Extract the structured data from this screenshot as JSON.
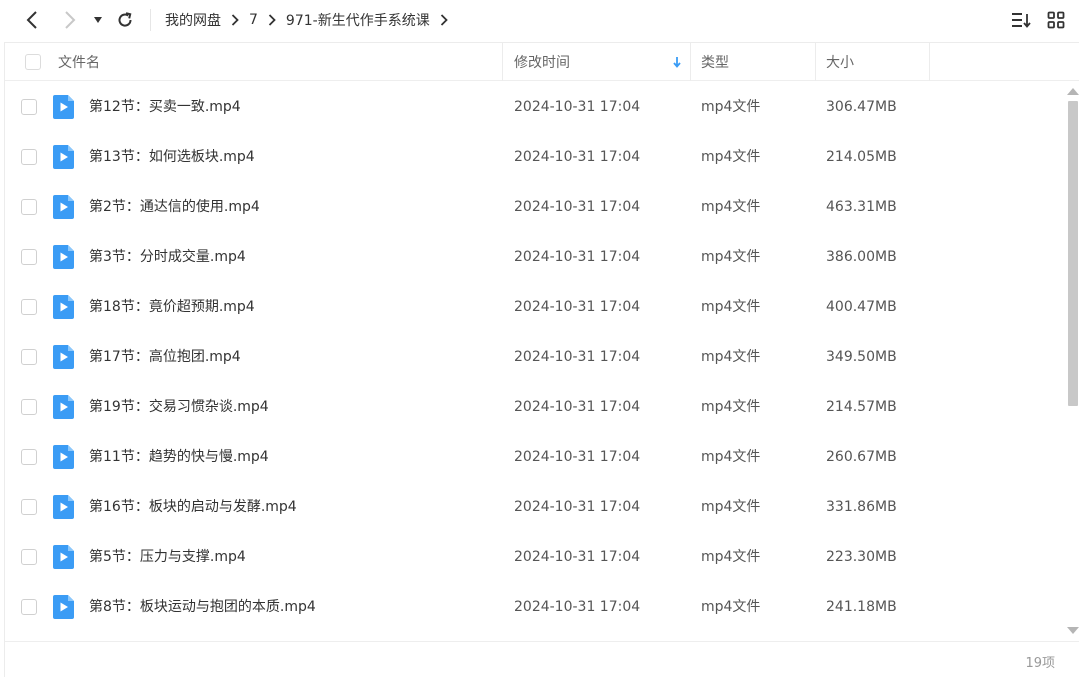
{
  "toolbar": {
    "back_icon": "chevron-left-icon",
    "forward_icon": "chevron-right-icon",
    "dropdown_icon": "caret-down-icon",
    "refresh_icon": "refresh-icon",
    "sort_icon": "sort-list-icon",
    "view_icon": "grid-view-icon"
  },
  "breadcrumb": {
    "items": [
      "我的网盘",
      "7",
      "971-新生代作手系统课"
    ]
  },
  "table": {
    "headers": {
      "name": "文件名",
      "modified": "修改时间",
      "type": "类型",
      "size": "大小"
    },
    "sort_indicator": "arrow-down-icon",
    "accent": "#3b9cf5",
    "rows": [
      {
        "name": "第12节：买卖一致.mp4",
        "modified": "2024-10-31 17:04",
        "type": "mp4文件",
        "size": "306.47MB"
      },
      {
        "name": "第13节：如何选板块.mp4",
        "modified": "2024-10-31 17:04",
        "type": "mp4文件",
        "size": "214.05MB"
      },
      {
        "name": "第2节：通达信的使用.mp4",
        "modified": "2024-10-31 17:04",
        "type": "mp4文件",
        "size": "463.31MB"
      },
      {
        "name": "第3节：分时成交量.mp4",
        "modified": "2024-10-31 17:04",
        "type": "mp4文件",
        "size": "386.00MB"
      },
      {
        "name": "第18节：竟价超预期.mp4",
        "modified": "2024-10-31 17:04",
        "type": "mp4文件",
        "size": "400.47MB"
      },
      {
        "name": "第17节：高位抱团.mp4",
        "modified": "2024-10-31 17:04",
        "type": "mp4文件",
        "size": "349.50MB"
      },
      {
        "name": "第19节：交易习惯杂谈.mp4",
        "modified": "2024-10-31 17:04",
        "type": "mp4文件",
        "size": "214.57MB"
      },
      {
        "name": "第11节：趋势的快与慢.mp4",
        "modified": "2024-10-31 17:04",
        "type": "mp4文件",
        "size": "260.67MB"
      },
      {
        "name": "第16节：板块的启动与发酵.mp4",
        "modified": "2024-10-31 17:04",
        "type": "mp4文件",
        "size": "331.86MB"
      },
      {
        "name": "第5节：压力与支撑.mp4",
        "modified": "2024-10-31 17:04",
        "type": "mp4文件",
        "size": "223.30MB"
      },
      {
        "name": "第8节：板块运动与抱团的本质.mp4",
        "modified": "2024-10-31 17:04",
        "type": "mp4文件",
        "size": "241.18MB"
      }
    ]
  },
  "footer": {
    "count": "19项"
  }
}
